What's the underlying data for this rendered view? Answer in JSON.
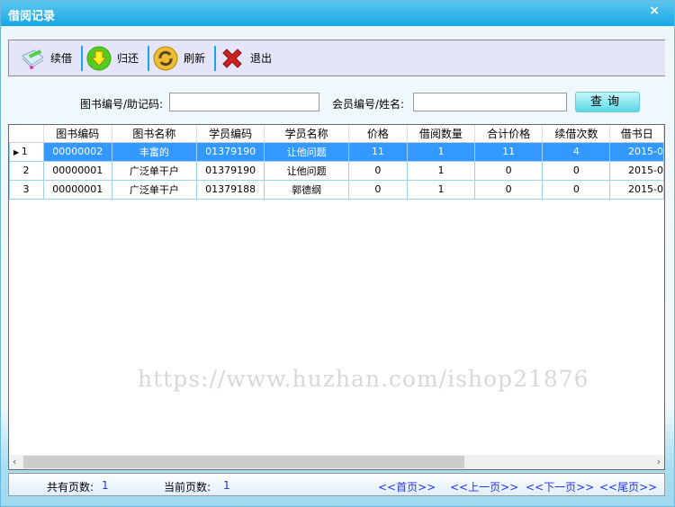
{
  "window": {
    "title": "借阅记录",
    "close": "×"
  },
  "toolbar": {
    "items": [
      {
        "label": "续借",
        "icon": "renew-icon"
      },
      {
        "label": "归还",
        "icon": "return-arrow-icon"
      },
      {
        "label": "刷新",
        "icon": "refresh-icon"
      },
      {
        "label": "退出",
        "icon": "exit-x-icon"
      }
    ]
  },
  "search": {
    "book_label": "图书编号/助记码:",
    "book_value": "",
    "member_label": "会员编号/姓名:",
    "member_value": "",
    "query_button": "查询"
  },
  "table": {
    "columns": [
      "图书编码",
      "图书名称",
      "学员编码",
      "学员名称",
      "价格",
      "借阅数量",
      "合计价格",
      "续借次数",
      "借书日"
    ],
    "rows": [
      {
        "n": "1",
        "cells": [
          "00000002",
          "丰富的",
          "01379190",
          "让他问题",
          "11",
          "1",
          "11",
          "4",
          "2015-0"
        ],
        "selected": true
      },
      {
        "n": "2",
        "cells": [
          "00000001",
          "广泛单干户",
          "01379190",
          "让他问题",
          "0",
          "1",
          "0",
          "0",
          "2015-0"
        ]
      },
      {
        "n": "3",
        "cells": [
          "00000001",
          "广泛单干户",
          "01379188",
          "郭德纲",
          "0",
          "1",
          "0",
          "0",
          "2015-0"
        ]
      }
    ]
  },
  "watermark": "https://www.huzhan.com/ishop21876",
  "footer": {
    "total_label": "共有页数:",
    "total": "1",
    "current_label": "当前页数:",
    "current": "1",
    "first": "<<首页>>",
    "prev": "<<上一页>>",
    "next": "<<下一页>>",
    "last": "<<尾页>>"
  }
}
